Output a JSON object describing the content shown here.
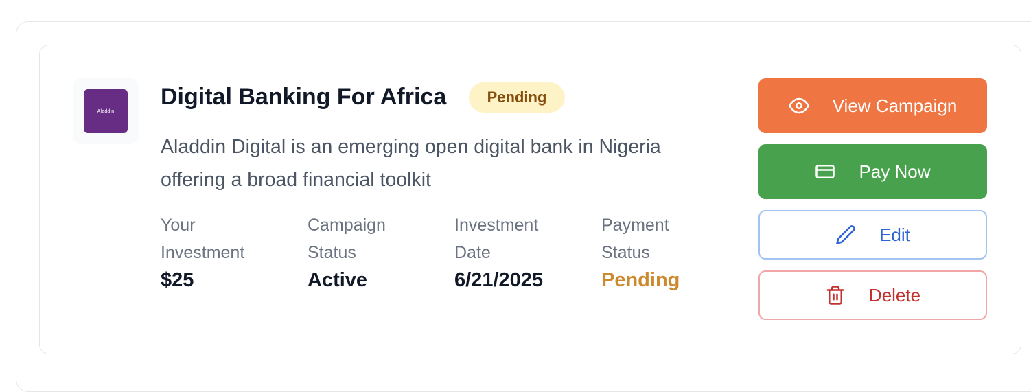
{
  "campaign": {
    "logo_text": "Aladdin",
    "title": "Digital Banking For Africa",
    "status_badge": "Pending",
    "description": "Aladdin Digital is an emerging open digital bank in Nigeria offering a broad financial toolkit"
  },
  "stats": [
    {
      "label": "Your Investment",
      "value": "$25"
    },
    {
      "label": "Campaign Status",
      "value": "Active"
    },
    {
      "label": "Investment Date",
      "value": "6/21/2025"
    },
    {
      "label": "Payment Status",
      "value": "Pending"
    }
  ],
  "actions": {
    "view_label": "View Campaign",
    "pay_label": "Pay Now",
    "edit_label": "Edit",
    "delete_label": "Delete"
  },
  "colors": {
    "view_button": "#ef7543",
    "pay_button": "#48a14d",
    "edit_button_text": "#2c63d6",
    "delete_button_text": "#c2312e",
    "badge_background": "#fef3c7",
    "payment_pending_text": "#ca8a2d",
    "logo_background": "#672d85"
  },
  "icons": {
    "view": "eye-icon",
    "pay": "credit-card-icon",
    "edit": "pencil-icon",
    "delete": "trash-icon"
  }
}
